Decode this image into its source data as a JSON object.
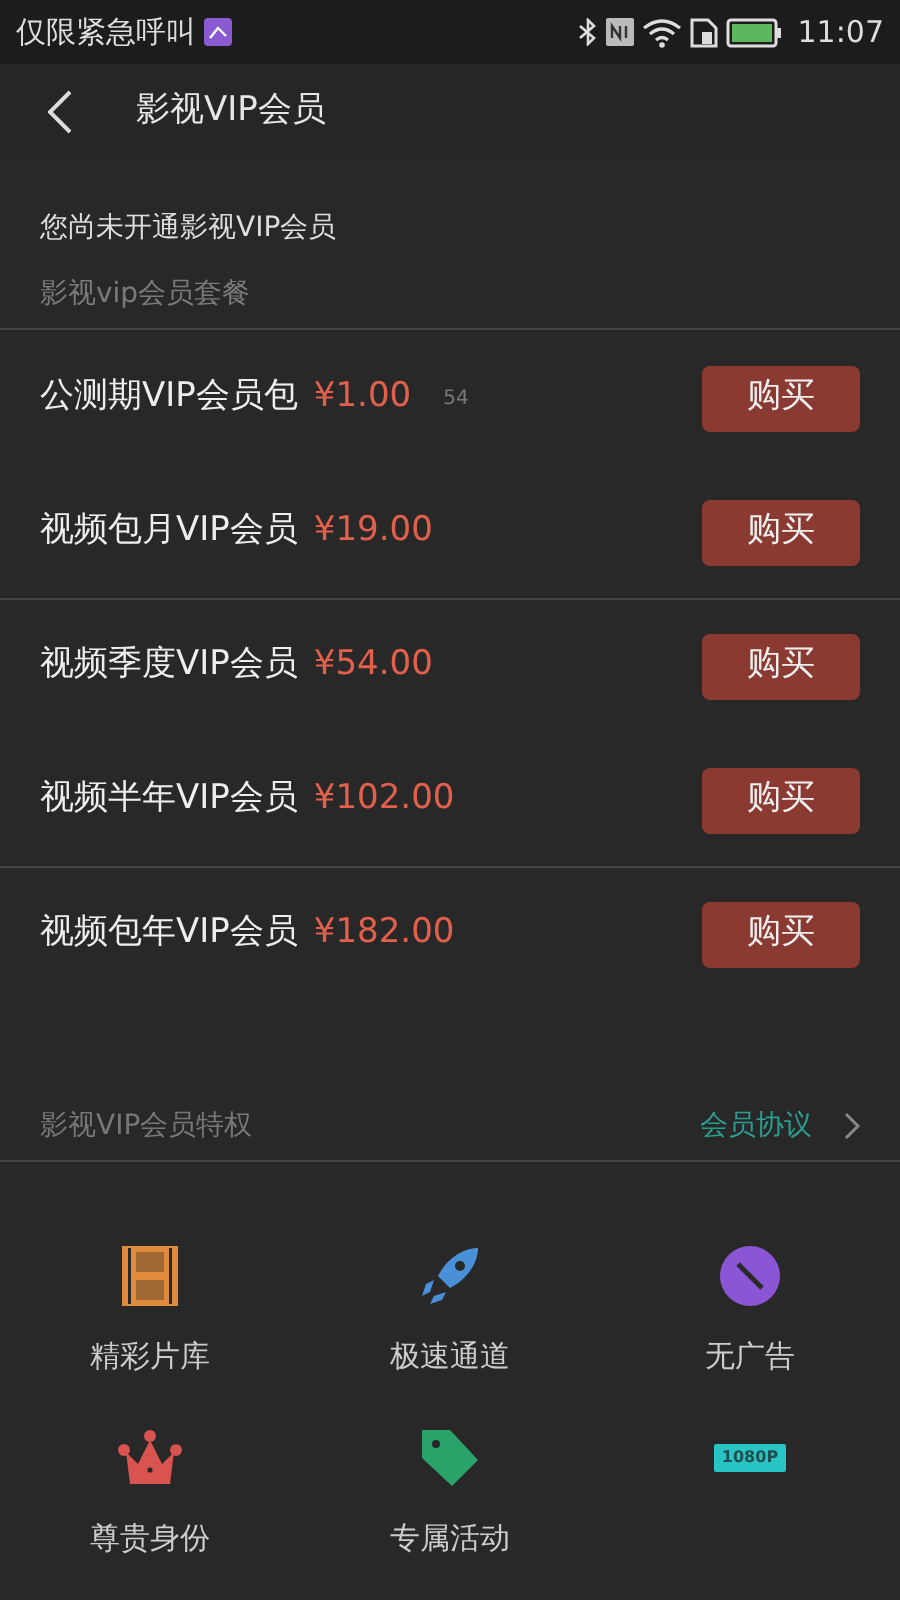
{
  "status_bar": {
    "carrier": "仅限紧急呼叫",
    "time": "11:07"
  },
  "header": {
    "title": "影视VIP会员"
  },
  "notice": "您尚未开通影视VIP会员",
  "plans_title": "影视vip会员套餐",
  "plans": [
    {
      "name": "公测期VIP会员包",
      "price": "¥1.00",
      "note": "54",
      "button": "购买",
      "divider_above": false
    },
    {
      "name": "视频包月VIP会员",
      "price": "¥19.00",
      "button": "购买",
      "divider_above": false
    },
    {
      "name": "视频季度VIP会员",
      "price": "¥54.00",
      "button": "购买",
      "divider_above": true
    },
    {
      "name": "视频半年VIP会员",
      "price": "¥102.00",
      "button": "购买",
      "divider_above": false
    },
    {
      "name": "视频包年VIP会员",
      "price": "¥182.00",
      "button": "购买",
      "divider_above": true
    }
  ],
  "privileges": {
    "title": "影视VIP会员特权",
    "link": "会员协议",
    "items": [
      {
        "kind": "film",
        "label": "精彩片库"
      },
      {
        "kind": "rocket",
        "label": "极速通道"
      },
      {
        "kind": "no-ads",
        "label": "无广告"
      },
      {
        "kind": "crown",
        "label": "尊贵身份"
      },
      {
        "kind": "tag",
        "label": "专属活动"
      },
      {
        "kind": "hd",
        "badge": "1080P"
      }
    ]
  }
}
